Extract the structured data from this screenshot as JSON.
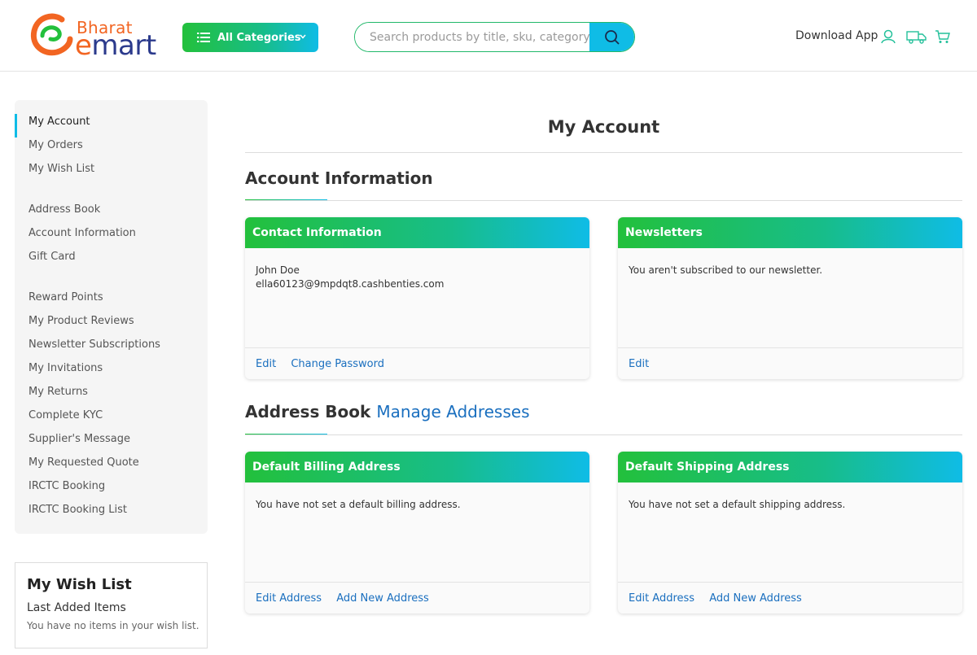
{
  "header": {
    "logo_text_top": "Bharat",
    "logo_text_bottom_e": "e",
    "logo_text_bottom_rest": "mart",
    "categories_label": "All Categories",
    "search_placeholder": "Search products by title, sku, category, b",
    "download_app": "Download App"
  },
  "sidebar": {
    "items": [
      "My Account",
      "My Orders",
      "My Wish List",
      "Address Book",
      "Account Information",
      "Gift Card",
      "Reward Points",
      "My Product Reviews",
      "Newsletter Subscriptions",
      "My Invitations",
      "My Returns",
      "Complete KYC",
      "Supplier's Message",
      "My Requested Quote",
      "IRCTC Booking",
      "IRCTC Booking List"
    ]
  },
  "wishlist": {
    "title": "My Wish List",
    "subtitle": "Last Added Items",
    "empty_text": "You have no items in your wish list."
  },
  "main": {
    "page_title": "My Account",
    "account_info_title": "Account Information",
    "address_book_title": "Address Book",
    "manage_addresses": "Manage Addresses",
    "contact": {
      "title": "Contact Information",
      "name": "John Doe",
      "email": "ella60123@9mpdqt8.cashbenties.com",
      "edit": "Edit",
      "change_password": "Change Password"
    },
    "newsletters": {
      "title": "Newsletters",
      "text": "You aren't subscribed to our newsletter.",
      "edit": "Edit"
    },
    "billing": {
      "title": "Default Billing Address",
      "text": "You have not set a default billing address.",
      "edit": "Edit Address",
      "add": "Add New Address"
    },
    "shipping": {
      "title": "Default Shipping Address",
      "text": "You have not set a default shipping address.",
      "edit": "Edit Address",
      "add": "Add New Address"
    }
  },
  "colors": {
    "accent_blue": "#0fbce6",
    "accent_green": "#23c03c",
    "link": "#1a6fbf",
    "brand_orange": "#f26522",
    "brand_navy": "#2b3a8c"
  }
}
